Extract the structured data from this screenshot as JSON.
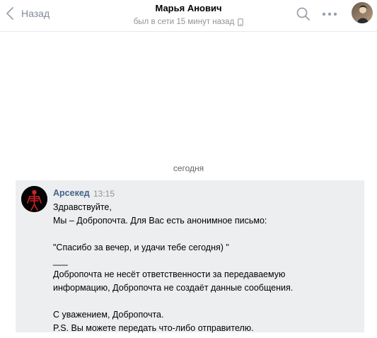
{
  "header": {
    "back_label": "Назад",
    "peer_name": "Марья Анович",
    "peer_status": "был в сети 15 минут назад",
    "status_device_icon": "mobile-phone-icon",
    "search_icon": "search-icon",
    "more_icon": "more-dots-icon"
  },
  "chat": {
    "date_divider": "сегодня",
    "messages": [
      {
        "author": "Арсекед",
        "time": "13:15",
        "lines": [
          "Здравствуйте,",
          "Мы – Добропочта. Для Вас есть анонимное письмо:",
          "",
          "\"Спасибо за вечер, и удачи тебе сегодня) \"",
          "___",
          "Добропочта не несёт ответственности за передаваемую",
          "информацию, Добропочта не создаёт данные сообщения.",
          "",
          "С уважением, Добропочта.",
          "P.S. Вы можете передать что-либо отправителю."
        ]
      }
    ]
  },
  "colors": {
    "author_link": "#42648b",
    "muted_text": "#939393",
    "message_bg": "#edeef0",
    "divider": "#e7e8ec"
  }
}
